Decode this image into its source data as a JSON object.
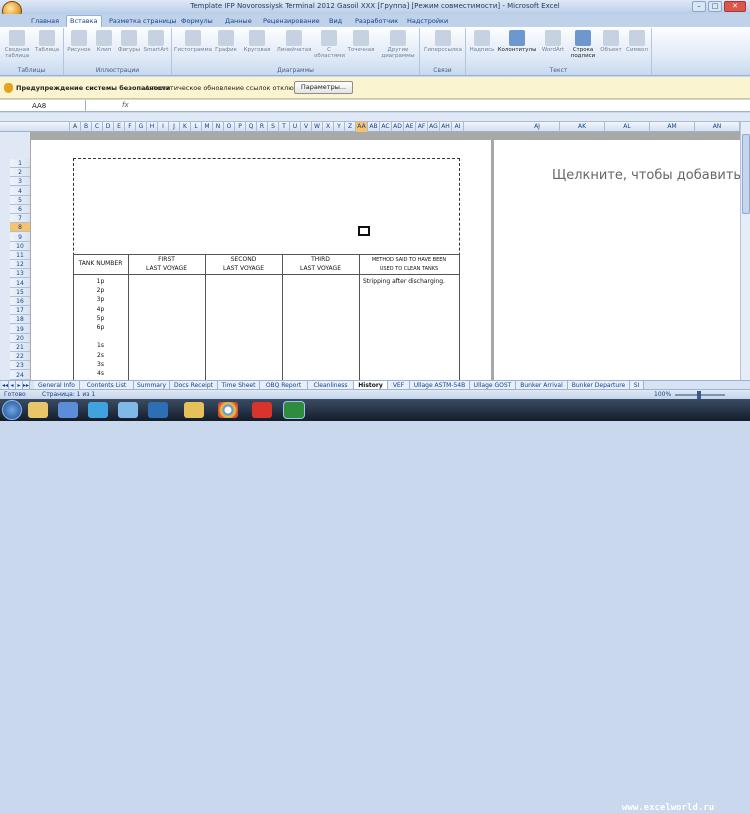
{
  "window": {
    "title": "Template IFP Novorossiysk Terminal 2012 Gasoil XXX [Группа] [Режим совместимости] - Microsoft Excel",
    "minimize": "–",
    "maximize": "□",
    "close": "✕"
  },
  "ribbon_tabs": [
    "Главная",
    "Вставка",
    "Разметка страницы",
    "Формулы",
    "Данные",
    "Рецензирование",
    "Вид",
    "Разработчик",
    "Надстройки"
  ],
  "active_tab": "Вставка",
  "groups": {
    "tables": {
      "label": "Таблицы",
      "buttons": [
        "Сводная таблица",
        "Таблица"
      ]
    },
    "illustrations": {
      "label": "Иллюстрации",
      "buttons": [
        "Рисунок",
        "Клип",
        "Фигуры",
        "SmartArt"
      ]
    },
    "charts": {
      "label": "Диаграммы",
      "buttons": [
        "Гистограмма",
        "График",
        "Круговая",
        "Линейчатая",
        "С областями",
        "Точечная",
        "Другие диаграммы"
      ]
    },
    "links": {
      "label": "Связи",
      "buttons": [
        "Гиперссылка"
      ]
    },
    "text": {
      "label": "Текст",
      "buttons": [
        "Надпись",
        "Колонтитулы",
        "WordArt",
        "Строка подписи",
        "Объект",
        "Символ"
      ]
    }
  },
  "security_bar": {
    "title": "Предупреждение системы безопасности",
    "message": "Автоматическое обновление ссылок отключено",
    "button": "Параметры..."
  },
  "formula_bar": {
    "name_box": "AA8",
    "fx": "fx",
    "value": ""
  },
  "columns": [
    "A",
    "B",
    "C",
    "D",
    "E",
    "F",
    "G",
    "H",
    "I",
    "J",
    "K",
    "L",
    "M",
    "N",
    "O",
    "P",
    "Q",
    "R",
    "S",
    "T",
    "U",
    "V",
    "W",
    "X",
    "Y",
    "Z",
    "AA",
    "AB",
    "AC",
    "AD",
    "AE",
    "AF",
    "AG",
    "AH",
    "AI"
  ],
  "columns_right": [
    "AJ",
    "AK",
    "AL",
    "AM",
    "AN"
  ],
  "selected_column": "AA",
  "rows": [
    "1",
    "2",
    "3",
    "4",
    "5",
    "6",
    "7",
    "8",
    "9",
    "10",
    "11",
    "12",
    "13",
    "14",
    "15",
    "16",
    "17",
    "18",
    "19",
    "20",
    "21",
    "22",
    "23",
    "24",
    "25"
  ],
  "selected_row": "8",
  "page2_text": "Щелкните, чтобы добавить да",
  "table": {
    "headers": [
      {
        "line1": "TANK NUMBER",
        "line2": ""
      },
      {
        "line1": "FIRST",
        "line2": "LAST VOYAGE"
      },
      {
        "line1": "SECOND",
        "line2": "LAST VOYAGE"
      },
      {
        "line1": "THIRD",
        "line2": "LAST VOYAGE"
      },
      {
        "line1": "METHOD SAID TO HAVE BEEN",
        "line2": "USED TO CLEAN TANKS"
      }
    ],
    "tanks": [
      "1p",
      "2p",
      "3p",
      "4p",
      "5p",
      "6p",
      "",
      "1s",
      "2s",
      "3s",
      "4s"
    ],
    "method_note": "Stripping after discharging."
  },
  "sheet_tabs": [
    "General Info",
    "Contents List",
    "Summary",
    "Docs Receipt",
    "Time Sheet",
    "OBQ Report",
    "Cleanliness",
    "History",
    "VEF",
    "Ullage ASTM-54B",
    "Ullage GOST",
    "Bunker Arrival",
    "Bunker Departure",
    "SI"
  ],
  "active_sheet": "History",
  "status": {
    "ready": "Готово",
    "page": "Страница: 1 из 1",
    "zoom": "100%"
  },
  "watermark": "www.excelworld.ru"
}
